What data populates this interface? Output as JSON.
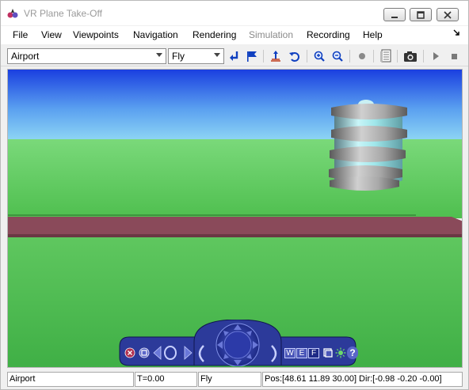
{
  "window": {
    "title": "VR Plane Take-Off"
  },
  "menu": {
    "items": [
      {
        "label": "File",
        "disabled": false
      },
      {
        "label": "View",
        "disabled": false
      },
      {
        "label": "Viewpoints",
        "disabled": false
      },
      {
        "label": "Navigation",
        "disabled": false
      },
      {
        "label": "Rendering",
        "disabled": false
      },
      {
        "label": "Simulation",
        "disabled": true
      },
      {
        "label": "Recording",
        "disabled": false
      },
      {
        "label": "Help",
        "disabled": false
      }
    ]
  },
  "toolbar": {
    "viewpoint_value": "Airport",
    "navigation_value": "Fly",
    "icons": [
      "return-to-viewpoint-icon",
      "add-viewpoint-flag-icon",
      "straighten-up-icon",
      "undo-move-icon",
      "zoom-in-icon",
      "zoom-out-icon",
      "record-icon",
      "capture-frame-icon",
      "snapshot-camera-icon",
      "play-icon",
      "stop-icon"
    ]
  },
  "navpanel": {
    "labels": {
      "w": "W",
      "e": "E",
      "f": "F",
      "help": "?"
    }
  },
  "status": {
    "viewpoint": "Airport",
    "time": "T=0.00",
    "nav_mode": "Fly",
    "position": "Pos:[48.61 11.89 30.00] Dir:[-0.98 -0.20 -0.00]"
  },
  "colors": {
    "sky": "#6aa8e8",
    "grass": "#5cc95c",
    "runway": "#8a4a5a",
    "nav_panel": "#2c3a9a"
  }
}
